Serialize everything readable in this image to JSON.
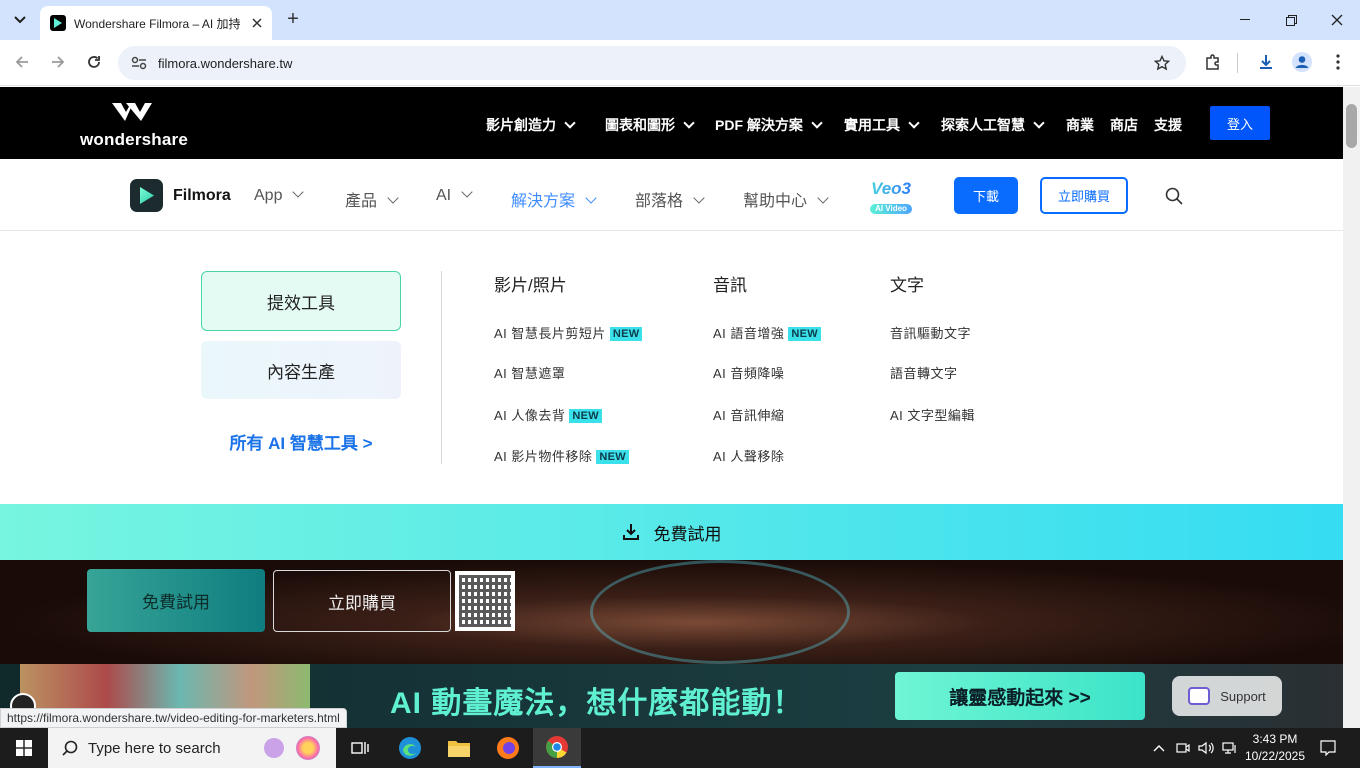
{
  "browser": {
    "tab_title": "Wondershare Filmora – AI 加持",
    "url": "filmora.wondershare.tw",
    "new_tab_symbol": "+",
    "status_url": "https://filmora.wondershare.tw/video-editing-for-marketers.html"
  },
  "ws_header": {
    "logo_text": "wondershare",
    "nav": [
      "影片創造力",
      "圖表和圖形",
      "PDF 解決方案",
      "實用工具",
      "探索人工智慧",
      "商業",
      "商店",
      "支援"
    ],
    "login_label": "登入"
  },
  "filmora_nav": {
    "brand": "Filmora",
    "items": [
      "App",
      "產品",
      "AI",
      "解決方案",
      "部落格",
      "幫助中心"
    ],
    "active_item": "解決方案",
    "veo_title": "Veo3",
    "veo_sub": "AI Video",
    "download_label": "下載",
    "buy_label": "立即購買"
  },
  "dropdown": {
    "categories": [
      "提效工具",
      "內容生產"
    ],
    "all_ai_link": "所有 AI 智慧工具 >",
    "columns": [
      {
        "heading": "影片/照片",
        "items": [
          "AI 智慧長片剪短片",
          "AI 智慧遮罩",
          "AI 人像去背",
          "AI 影片物件移除"
        ],
        "new": [
          true,
          false,
          true,
          true
        ]
      },
      {
        "heading": "音訊",
        "items": [
          "AI 語音增強",
          "AI 音頻降噪",
          "AI 音訊伸縮",
          "AI 人聲移除"
        ],
        "new": [
          true,
          false,
          false,
          false
        ]
      },
      {
        "heading": "文字",
        "items": [
          "音訊驅動文字",
          "語音轉文字",
          "AI 文字型編輯"
        ],
        "new": [
          false,
          false,
          false
        ]
      }
    ],
    "new_badge": "NEW"
  },
  "trial_bar": {
    "label": "免費試用"
  },
  "hero": {
    "trial_label": "免費試用",
    "buy_label": "立即購買"
  },
  "banner": {
    "headline": "AI 動畫魔法，想什麼都能動！",
    "cta": "讓靈感動起來 >>",
    "support_label": "Support"
  },
  "taskbar": {
    "search_placeholder": "Type here to search",
    "time": "3:43 PM",
    "date": "10/22/2025"
  },
  "colors": {
    "ws_blue": "#0055fb",
    "filmora_blue": "#0a6cff",
    "trial_cyan": "#35dcf2",
    "mint": "#5ff0d2"
  }
}
